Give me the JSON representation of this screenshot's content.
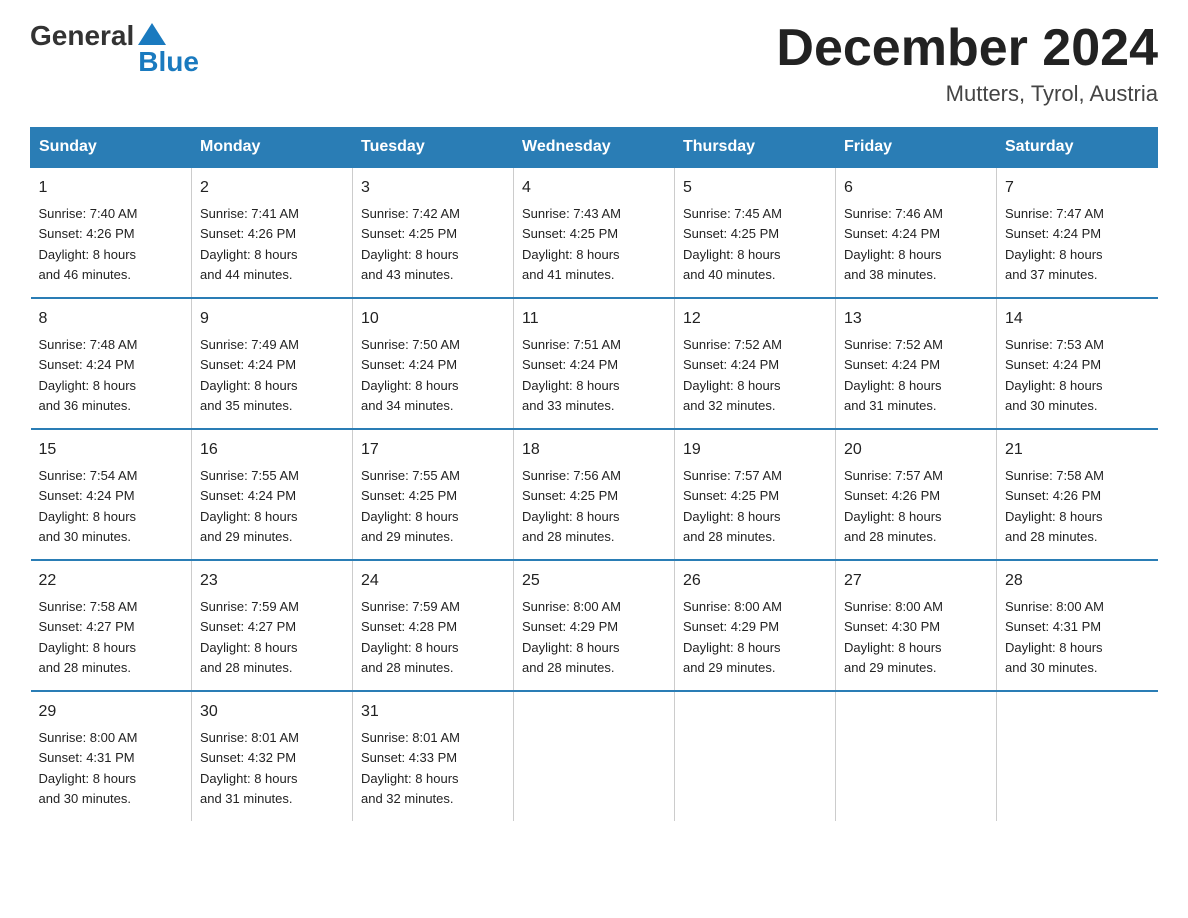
{
  "header": {
    "title": "December 2024",
    "location": "Mutters, Tyrol, Austria",
    "logo_general": "General",
    "logo_blue": "Blue"
  },
  "calendar": {
    "days_of_week": [
      "Sunday",
      "Monday",
      "Tuesday",
      "Wednesday",
      "Thursday",
      "Friday",
      "Saturday"
    ],
    "weeks": [
      [
        {
          "day": "1",
          "sunrise": "7:40 AM",
          "sunset": "4:26 PM",
          "daylight": "8 hours and 46 minutes."
        },
        {
          "day": "2",
          "sunrise": "7:41 AM",
          "sunset": "4:26 PM",
          "daylight": "8 hours and 44 minutes."
        },
        {
          "day": "3",
          "sunrise": "7:42 AM",
          "sunset": "4:25 PM",
          "daylight": "8 hours and 43 minutes."
        },
        {
          "day": "4",
          "sunrise": "7:43 AM",
          "sunset": "4:25 PM",
          "daylight": "8 hours and 41 minutes."
        },
        {
          "day": "5",
          "sunrise": "7:45 AM",
          "sunset": "4:25 PM",
          "daylight": "8 hours and 40 minutes."
        },
        {
          "day": "6",
          "sunrise": "7:46 AM",
          "sunset": "4:24 PM",
          "daylight": "8 hours and 38 minutes."
        },
        {
          "day": "7",
          "sunrise": "7:47 AM",
          "sunset": "4:24 PM",
          "daylight": "8 hours and 37 minutes."
        }
      ],
      [
        {
          "day": "8",
          "sunrise": "7:48 AM",
          "sunset": "4:24 PM",
          "daylight": "8 hours and 36 minutes."
        },
        {
          "day": "9",
          "sunrise": "7:49 AM",
          "sunset": "4:24 PM",
          "daylight": "8 hours and 35 minutes."
        },
        {
          "day": "10",
          "sunrise": "7:50 AM",
          "sunset": "4:24 PM",
          "daylight": "8 hours and 34 minutes."
        },
        {
          "day": "11",
          "sunrise": "7:51 AM",
          "sunset": "4:24 PM",
          "daylight": "8 hours and 33 minutes."
        },
        {
          "day": "12",
          "sunrise": "7:52 AM",
          "sunset": "4:24 PM",
          "daylight": "8 hours and 32 minutes."
        },
        {
          "day": "13",
          "sunrise": "7:52 AM",
          "sunset": "4:24 PM",
          "daylight": "8 hours and 31 minutes."
        },
        {
          "day": "14",
          "sunrise": "7:53 AM",
          "sunset": "4:24 PM",
          "daylight": "8 hours and 30 minutes."
        }
      ],
      [
        {
          "day": "15",
          "sunrise": "7:54 AM",
          "sunset": "4:24 PM",
          "daylight": "8 hours and 30 minutes."
        },
        {
          "day": "16",
          "sunrise": "7:55 AM",
          "sunset": "4:24 PM",
          "daylight": "8 hours and 29 minutes."
        },
        {
          "day": "17",
          "sunrise": "7:55 AM",
          "sunset": "4:25 PM",
          "daylight": "8 hours and 29 minutes."
        },
        {
          "day": "18",
          "sunrise": "7:56 AM",
          "sunset": "4:25 PM",
          "daylight": "8 hours and 28 minutes."
        },
        {
          "day": "19",
          "sunrise": "7:57 AM",
          "sunset": "4:25 PM",
          "daylight": "8 hours and 28 minutes."
        },
        {
          "day": "20",
          "sunrise": "7:57 AM",
          "sunset": "4:26 PM",
          "daylight": "8 hours and 28 minutes."
        },
        {
          "day": "21",
          "sunrise": "7:58 AM",
          "sunset": "4:26 PM",
          "daylight": "8 hours and 28 minutes."
        }
      ],
      [
        {
          "day": "22",
          "sunrise": "7:58 AM",
          "sunset": "4:27 PM",
          "daylight": "8 hours and 28 minutes."
        },
        {
          "day": "23",
          "sunrise": "7:59 AM",
          "sunset": "4:27 PM",
          "daylight": "8 hours and 28 minutes."
        },
        {
          "day": "24",
          "sunrise": "7:59 AM",
          "sunset": "4:28 PM",
          "daylight": "8 hours and 28 minutes."
        },
        {
          "day": "25",
          "sunrise": "8:00 AM",
          "sunset": "4:29 PM",
          "daylight": "8 hours and 28 minutes."
        },
        {
          "day": "26",
          "sunrise": "8:00 AM",
          "sunset": "4:29 PM",
          "daylight": "8 hours and 29 minutes."
        },
        {
          "day": "27",
          "sunrise": "8:00 AM",
          "sunset": "4:30 PM",
          "daylight": "8 hours and 29 minutes."
        },
        {
          "day": "28",
          "sunrise": "8:00 AM",
          "sunset": "4:31 PM",
          "daylight": "8 hours and 30 minutes."
        }
      ],
      [
        {
          "day": "29",
          "sunrise": "8:00 AM",
          "sunset": "4:31 PM",
          "daylight": "8 hours and 30 minutes."
        },
        {
          "day": "30",
          "sunrise": "8:01 AM",
          "sunset": "4:32 PM",
          "daylight": "8 hours and 31 minutes."
        },
        {
          "day": "31",
          "sunrise": "8:01 AM",
          "sunset": "4:33 PM",
          "daylight": "8 hours and 32 minutes."
        },
        null,
        null,
        null,
        null
      ]
    ]
  },
  "labels": {
    "sunrise": "Sunrise:",
    "sunset": "Sunset:",
    "daylight": "Daylight:"
  }
}
